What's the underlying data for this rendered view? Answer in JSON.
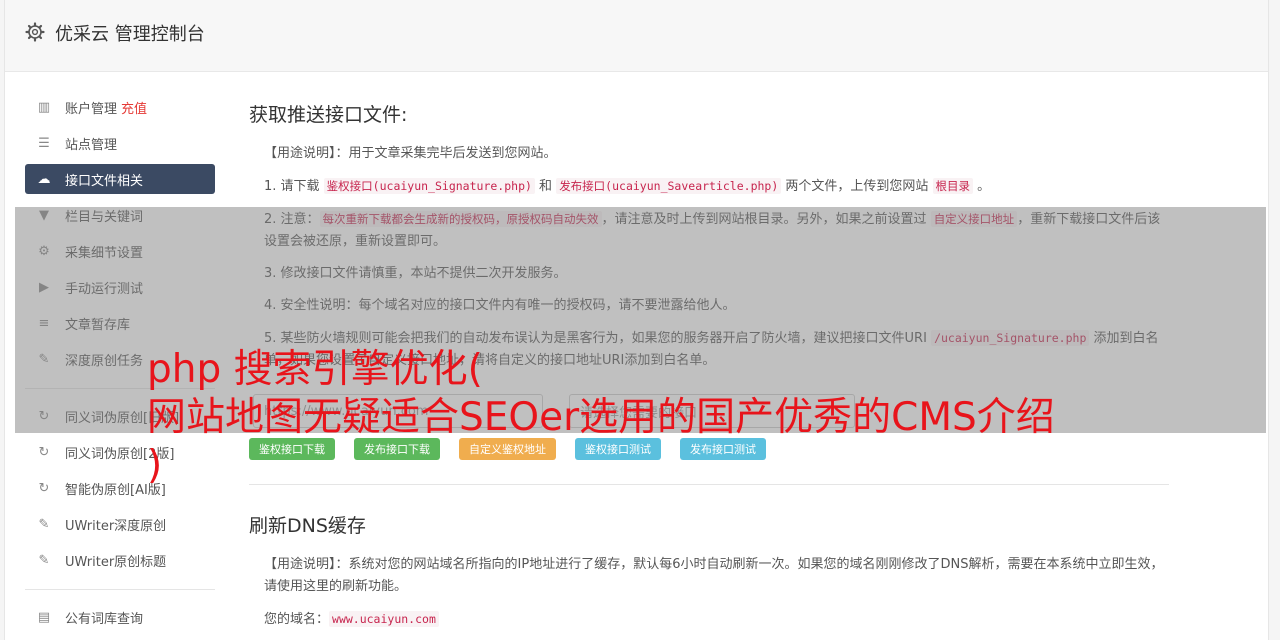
{
  "header": {
    "title": "优采云 管理控制台",
    "icon": "gear-icon"
  },
  "sidebar": {
    "items": [
      {
        "label": "账户管理",
        "badge": "充值",
        "icon": "bar-chart-icon"
      },
      {
        "label": "站点管理",
        "icon": "server-icon"
      },
      {
        "label": "接口文件相关",
        "icon": "cloud-upload-icon",
        "active": true
      },
      {
        "label": "栏目与关键词",
        "icon": "filter-icon"
      },
      {
        "label": "采集细节设置",
        "icon": "cogs-icon"
      },
      {
        "label": "手动运行测试",
        "icon": "play-circle-icon"
      },
      {
        "label": "文章暂存库",
        "icon": "database-icon"
      },
      {
        "label": "深度原创任务",
        "icon": "edit-icon"
      },
      {
        "label": "同义词伪原创[旧版]",
        "icon": "refresh-icon"
      },
      {
        "label": "同义词伪原创[2版]",
        "icon": "refresh-icon"
      },
      {
        "label": "智能伪原创[AI版]",
        "icon": "refresh-icon"
      },
      {
        "label": "UWriter深度原创",
        "icon": "edit-icon"
      },
      {
        "label": "UWriter原创标题",
        "icon": "edit-icon"
      },
      {
        "label": "公有词库查询",
        "icon": "book-icon"
      }
    ]
  },
  "section1": {
    "title": "获取推送接口文件:",
    "usage_label": "【用途说明】：",
    "usage_text": "用于文章采集完毕后发送到您网站。",
    "p1": {
      "a": "1. 请下载 ",
      "code1": "鉴权接口(ucaiyun_Signature.php)",
      "b": " 和 ",
      "code2": "发布接口(ucaiyun_Savearticle.php)",
      "c": " 两个文件，上传到您网站 ",
      "code3": "根目录",
      "d": " 。"
    },
    "p2": {
      "a": "2. 注意：",
      "code1": "每次重新下载都会生成新的授权码，原授权码自动失效",
      "b": "，请注意及时上传到网站根目录。另外，如果之前设置过 ",
      "code2": "自定义接口地址",
      "c": "，重新下载接口文件后该设置会被还原，重新设置即可。"
    },
    "p3": "3. 修改接口文件请慎重，本站不提供二次开发服务。",
    "p4": "4. 安全性说明：每个域名对应的接口文件内有唯一的授权码，请不要泄露给他人。",
    "p5": {
      "a": "5. 某些防火墙规则可能会把我们的自动发布误认为是黑客行为，如果您的服务器开启了防火墙，建议把接口文件URI ",
      "code1": "/ucaiyun_Signature.php",
      "b": " 添加到白名单，如果您设置了自定义接口地址，请将自定义的接口地址URI添加到白名单。"
    },
    "url_placeholder": "https://www.ucaiyun.com",
    "select_placeholder": "请选择您需要的接口",
    "buttons": [
      "鉴权接口下载",
      "发布接口下载",
      "自定义鉴权地址",
      "鉴权接口测试",
      "发布接口测试"
    ]
  },
  "section2": {
    "title": "刷新DNS缓存",
    "usage_label": "【用途说明】：",
    "usage_text": "系统对您的网站域名所指向的IP地址进行了缓存，默认每6小时自动刷新一次。如果您的域名刚刚修改了DNS解析，需要在本系统中立即生效，请使用这里的刷新功能。",
    "domain_label": "您的域名：",
    "domain_value": "www.ucaiyun.com"
  },
  "overlay_text": {
    "line1": "php 搜索引擎优化(",
    "line2": "网站地图无疑适合SEOer选用的国产优秀的CMS介绍",
    "line3": ")"
  },
  "colors": {
    "active_nav": "#3b4a63",
    "code_red": "#c7254e",
    "ad_red": "#e8141b",
    "green": "#5cb85c",
    "orange": "#f0ad4e",
    "blue": "#5bc0de"
  }
}
